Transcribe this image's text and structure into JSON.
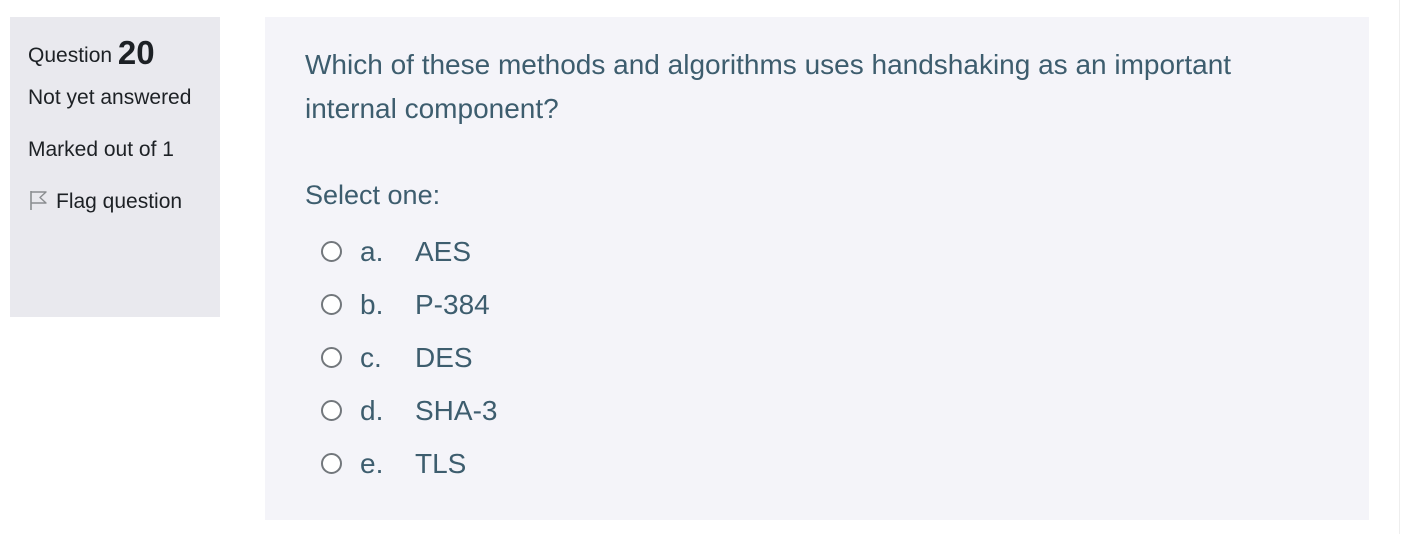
{
  "info": {
    "question_label": "Question",
    "question_number": "20",
    "state": "Not yet answered",
    "grade": "Marked out of 1",
    "flag_label": "Flag question",
    "flag_icon": "flag-outline-icon"
  },
  "question": {
    "text": "Which of these methods and algorithms uses handshaking as an important internal component?",
    "prompt": "Select one:",
    "options": [
      {
        "letter": "a.",
        "text": "AES"
      },
      {
        "letter": "b.",
        "text": "P-384"
      },
      {
        "letter": "c.",
        "text": "DES"
      },
      {
        "letter": "d.",
        "text": "SHA-3"
      },
      {
        "letter": "e.",
        "text": "TLS"
      }
    ]
  },
  "colors": {
    "info_bg": "#e9e9ee",
    "content_bg": "#f4f4f9",
    "question_text": "#3d5d6e",
    "info_text": "#1d2125"
  }
}
